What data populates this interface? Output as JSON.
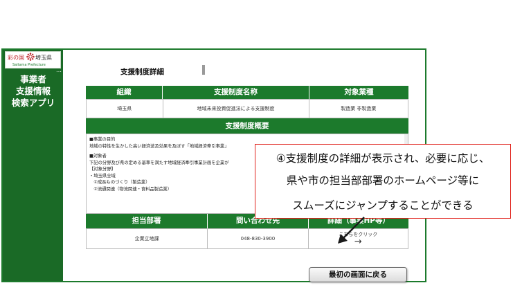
{
  "logo": {
    "left_text": "彩の国",
    "right_text": "埼玉県",
    "sub_text": "Saitama Prefecture"
  },
  "sidebar": {
    "menu_dots": "…",
    "title_lines": [
      "事業者",
      "支援情報",
      "検索アプリ"
    ]
  },
  "page": {
    "heading": "支援制度詳細"
  },
  "table1": {
    "headers": [
      "組織",
      "支援制度名称",
      "対象業種"
    ],
    "values": [
      "埼玉県",
      "地域未来投資促進法による支援制度",
      "製造業 非製造業"
    ]
  },
  "overview": {
    "header": "支援制度概要",
    "lines": [
      "■事業の目的",
      "地域の特性を生かした高い経済波及効果を及ぼす「地域経済牽引事業」",
      "■対象者",
      "下記の分野及び県の定める基準を満たす地域経済牽引事業計画を企業が",
      "【対象分野】",
      "・埼玉県全域",
      "　①成長ものづくり（製造業）",
      "　②流通関連（物流関連・食料品製造業）"
    ]
  },
  "table2": {
    "headers": [
      "担当部署",
      "問い合わせ先",
      "詳細（事業HP等）"
    ],
    "values": [
      "企業立地課",
      "048-830-3900"
    ],
    "link_text": "こちらをクリック",
    "link_arrow": "→"
  },
  "back_button": "最初の画面に戻る",
  "callout": {
    "lines": [
      "④支援制度の詳細が表示され、必要に応じ、",
      "県や市の担当部部署のホームページ等に",
      "スムーズにジャンプすることができる"
    ]
  },
  "colors": {
    "brand_green": "#1c7a2c",
    "sidebar_green": "#1a6a26",
    "callout_red": "#e0201a"
  }
}
